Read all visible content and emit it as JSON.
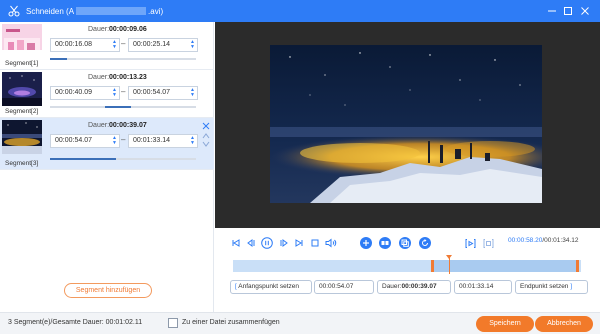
{
  "window": {
    "title_prefix": "Schneiden (A",
    "title_suffix": ".avi)",
    "minimize_icon": "minimize-icon",
    "maximize_icon": "maximize-icon",
    "close_icon": "close-icon"
  },
  "segments": [
    {
      "label": "Segment[1]",
      "dauer_label": "Dauer:",
      "dauer": "00:00:09.06",
      "start": "00:00:16.08",
      "end": "00:00:25.14",
      "progress": 0.12,
      "progress_start": 0.0
    },
    {
      "label": "Segment[2]",
      "dauer_label": "Dauer:",
      "dauer": "00:00:13.23",
      "start": "00:00:40.09",
      "end": "00:00:54.07",
      "progress": 0.18,
      "progress_start": 0.38
    },
    {
      "label": "Segment[3]",
      "dauer_label": "Dauer:",
      "dauer": "00:00:39.07",
      "start": "00:00:54.07",
      "end": "00:01:33.14",
      "progress": 0.45,
      "progress_start": 0.0
    }
  ],
  "add_segment_label": "Segment hinzufügen",
  "player": {
    "current_time": "00:00:58.20",
    "total_time": "/00:01:34.12",
    "selection_start": 0.57,
    "selection_end": 0.99,
    "playhead": 0.62
  },
  "trim": {
    "set_start_label": "Anfangspunkt setzen",
    "start_value": "00:00:54.07",
    "dauer_label": "Dauer:",
    "dauer_value": "00:00:39.07",
    "end_value": "00:01:33.14",
    "set_end_label": "Endpunkt setzen"
  },
  "footer": {
    "summary": "3 Segment(e)/Gesamte Dauer: 00:01:02.11",
    "merge_label": "Zu einer Datei zusammenfügen",
    "save_label": "Speichern",
    "cancel_label": "Abbrechen"
  },
  "colors": {
    "accent": "#2e7cf6",
    "orange": "#f27a2a"
  }
}
